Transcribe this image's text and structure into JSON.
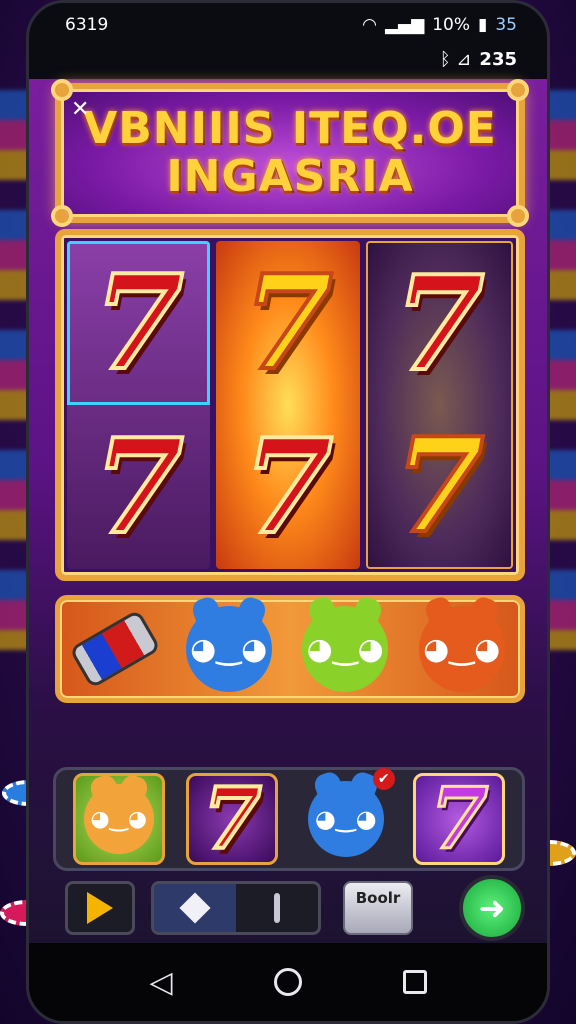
{
  "status": {
    "time": "6319",
    "battery": "10%",
    "signal_right": "35",
    "sub_value": "235",
    "sub_icons": "ᛒ  ⊿"
  },
  "title": {
    "line1": "VBNIIIS ITEQ.OE",
    "line2": "INGASRIA",
    "close_symbol": "✕"
  },
  "reels": [
    [
      {
        "symbol": "7",
        "color": "red",
        "selected": true
      },
      {
        "symbol": "7",
        "color": "red"
      }
    ],
    [
      {
        "symbol": "7",
        "color": "yellow"
      },
      {
        "symbol": "7",
        "color": "red"
      }
    ],
    [
      {
        "symbol": "7",
        "color": "red"
      },
      {
        "symbol": "7",
        "color": "yellow"
      }
    ]
  ],
  "bonus_strip": [
    "battery-can",
    "blue-cat",
    "green-cat",
    "orange-bear"
  ],
  "tray": [
    {
      "type": "critter",
      "name": "gold-cat"
    },
    {
      "type": "seven",
      "label": "7"
    },
    {
      "type": "critter",
      "name": "blue-cat",
      "badge": "✔"
    },
    {
      "type": "seven",
      "label": "7"
    }
  ],
  "controls": {
    "score_label": "Boolr"
  },
  "colors": {
    "accent_gold": "#e9a33c",
    "reel_red": "#d4141a",
    "reel_yellow": "#ffd21a",
    "go_green": "#17a83a"
  }
}
